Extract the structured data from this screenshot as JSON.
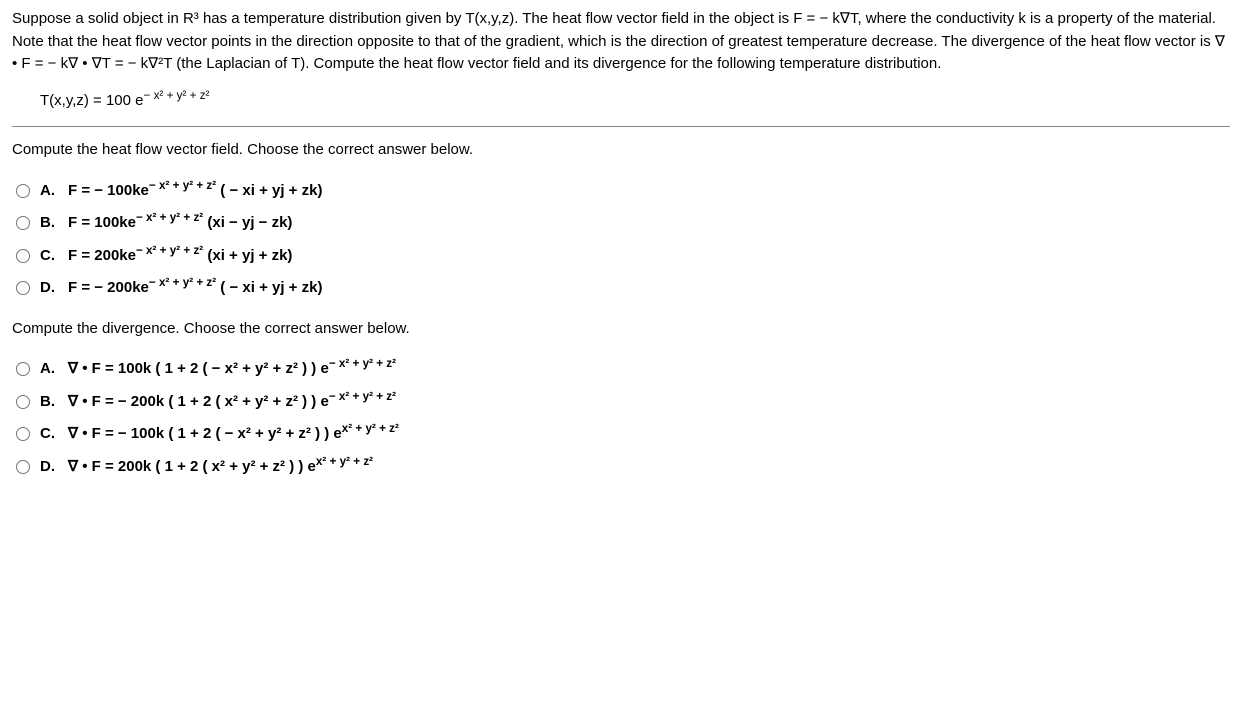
{
  "problem": {
    "intro": "Suppose a solid object in R³ has a temperature distribution given by T(x,y,z). The heat flow vector field in the object is F = − k∇T, where the conductivity k is a property of the material. Note that the heat flow vector points in the direction opposite to that of the gradient, which is the direction of greatest temperature decrease. The divergence of the heat flow vector is ∇ • F = − k∇ • ∇T = − k∇²T (the Laplacian of T). Compute the heat flow vector field and its divergence for the following temperature distribution.",
    "T_prefix": "T(x,y,z) = 100 e",
    "T_exp": "− x² + y² + z²"
  },
  "q1": {
    "prompt": "Compute the heat flow vector field. Choose the correct answer below.",
    "options": {
      "A": {
        "label": "A.",
        "pre": "F = − 100ke",
        "exp": "− x² + y² + z²",
        "post": " ( − xi + yj + zk)"
      },
      "B": {
        "label": "B.",
        "pre": "F = 100ke",
        "exp": "− x² + y² + z²",
        "post": " (xi − yj − zk)"
      },
      "C": {
        "label": "C.",
        "pre": "F = 200ke",
        "exp": "− x² + y² + z²",
        "post": " (xi + yj + zk)"
      },
      "D": {
        "label": "D.",
        "pre": "F = − 200ke",
        "exp": "− x² + y² + z²",
        "post": " ( − xi + yj + zk)"
      }
    }
  },
  "q2": {
    "prompt": "Compute the divergence. Choose the correct answer below.",
    "options": {
      "A": {
        "label": "A.",
        "pre": "∇ • F = 100k ( 1 + 2 ( − x² + y² + z² ) )  e",
        "exp": "− x² + y² + z²"
      },
      "B": {
        "label": "B.",
        "pre": "∇ • F = − 200k ( 1 + 2 ( x² + y² + z² ) )  e",
        "exp": "− x² + y² + z²"
      },
      "C": {
        "label": "C.",
        "pre": "∇ • F = − 100k ( 1 + 2 ( − x² + y² + z² ) )  e",
        "exp": "x² + y² + z²"
      },
      "D": {
        "label": "D.",
        "pre": "∇ • F = 200k ( 1 + 2 ( x² + y² + z² ) )  e",
        "exp": "x² + y² + z²"
      }
    }
  }
}
